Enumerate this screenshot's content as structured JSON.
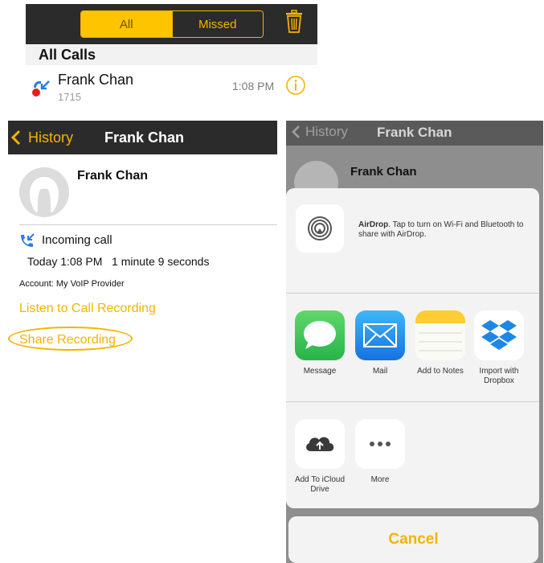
{
  "calls_list": {
    "tabs": [
      "All",
      "Missed"
    ],
    "section_header": "All Calls",
    "item": {
      "name": "Frank Chan",
      "number": "1715",
      "time": "1:08 PM"
    }
  },
  "detail": {
    "back_label": "History",
    "title": "Frank Chan",
    "contact_name": "Frank Chan",
    "call_type": "Incoming call",
    "date_duration": "Today 1:08 PM   1 minute 9 seconds",
    "account": "Account: My VoIP Provider",
    "listen_link": "Listen to Call Recording",
    "share_link": "Share Recording"
  },
  "share_sheet": {
    "back_label": "History",
    "title": "Frank Chan",
    "contact_name": "Frank Chan",
    "airdrop_title": "AirDrop",
    "airdrop_text": ". Tap to turn on Wi-Fi and Bluetooth to share with AirDrop.",
    "apps": [
      "Message",
      "Mail",
      "Add to Notes",
      "Import with Dropbox"
    ],
    "actions": [
      "Add To iCloud Drive",
      "More"
    ],
    "cancel": "Cancel"
  },
  "colors": {
    "accent": "#f4b400",
    "bar": "#2b2b2b"
  }
}
